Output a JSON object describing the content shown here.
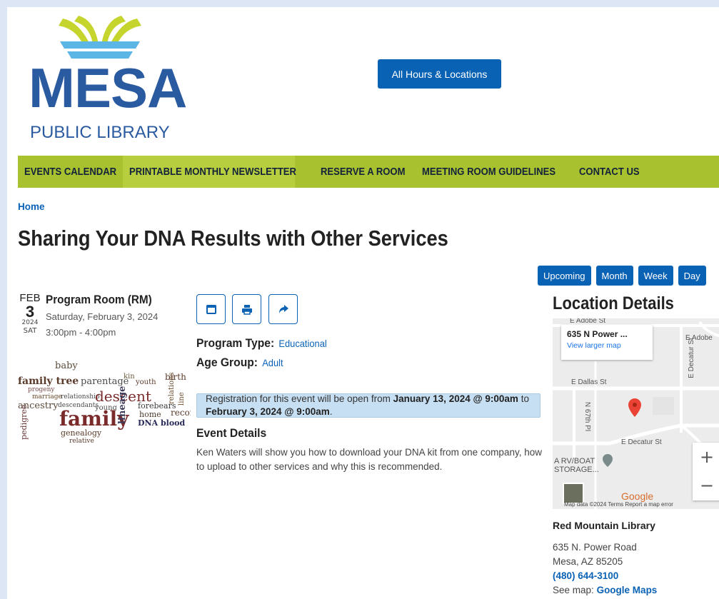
{
  "header": {
    "logo_title": "MESA",
    "logo_subtitle": "PUBLIC LIBRARY",
    "hours_button": "All Hours & Locations"
  },
  "nav": {
    "items": [
      {
        "label": "EVENTS CALENDAR"
      },
      {
        "label": "PRINTABLE MONTHLY NEWSLETTER"
      },
      {
        "label": "RESERVE A ROOM"
      },
      {
        "label": "MEETING ROOM GUIDELINES"
      },
      {
        "label": "CONTACT US"
      }
    ],
    "active_index": 1
  },
  "breadcrumb": {
    "home": "Home"
  },
  "event": {
    "title": "Sharing Your DNA Results with Other Services",
    "month": "FEB",
    "day": "3",
    "year": "2024",
    "weekday": "SAT",
    "room": "Program Room (RM)",
    "date_full": "Saturday, February 3, 2024",
    "time": "3:00pm - 4:00pm",
    "program_type_label": "Program Type:",
    "program_type_value": "Educational",
    "age_group_label": "Age Group:",
    "age_group_value": "Adult",
    "registration_prefix": "Registration for this event will be open from",
    "registration_start": "January 13, 2024 @ 9:00am",
    "registration_mid": "to",
    "registration_end": "February 3, 2024 @ 9:00am",
    "details_heading": "Event Details",
    "details_body": "Ken Waters will show you how to download your DNA kit from one company, how to upload to other services and why this is recommended."
  },
  "view_buttons": [
    "Upcoming",
    "Month",
    "Week",
    "Day"
  ],
  "action_icons": [
    "calendar-icon",
    "print-icon",
    "share-icon"
  ],
  "wordcloud": {
    "words": [
      "family tree",
      "parentage",
      "descent",
      "family",
      "ancestry",
      "marriage",
      "relationship",
      "lineage",
      "genealogy",
      "kin",
      "youth",
      "birth",
      "record",
      "home",
      "forebears",
      "baby",
      "DNA blood",
      "pedigree",
      "relative",
      "descendants",
      "young",
      "progeny",
      "relations",
      "line"
    ]
  },
  "location": {
    "heading": "Location Details",
    "map_card_title": "635 N Power ...",
    "map_card_link": "View larger map",
    "streets": [
      "E Adobe St",
      "E Adobe",
      "E Dallas St",
      "E Decatur St",
      "E Decatur St",
      "N 67th Pl",
      "A RV/BOAT",
      "STORAGE..."
    ],
    "map_attribution": "Map data ©2024   Terms   Report a map error",
    "google": "Google",
    "library_name": "Red Mountain Library",
    "address_line1": "635 N. Power Road",
    "address_line2": "Mesa, AZ 85205",
    "phone": "(480) 644-3100",
    "see_map_label": "See map:",
    "see_map_link": "Google Maps"
  },
  "colors": {
    "brand_blue": "#0a62b5",
    "nav_green": "#a7c12f",
    "notice_bg": "#c7dff2",
    "logo_blue": "#2a5aa0",
    "logo_yellow": "#c6d52d",
    "logo_lightblue": "#5bb6e6"
  }
}
